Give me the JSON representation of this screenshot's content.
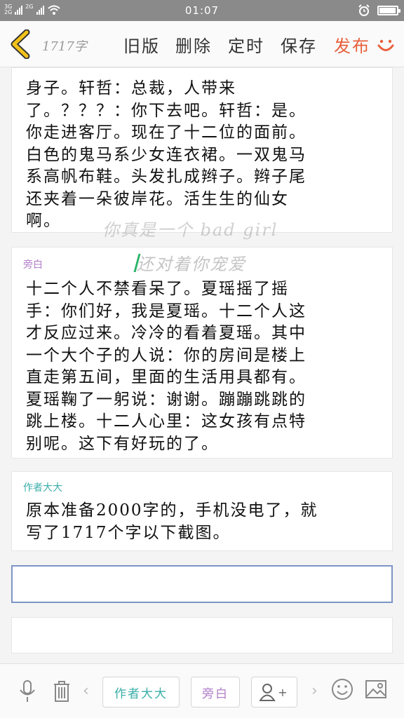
{
  "status_bar": {
    "network_1": "3G",
    "network_2": "2G",
    "network_3": "2G",
    "time": "01:07",
    "battery_level": 0.95
  },
  "toolbar": {
    "word_count": "1717字",
    "old_version_label": "旧版",
    "delete_label": "删除",
    "schedule_label": "定时",
    "save_label": "保存",
    "publish_label": "发布",
    "accent_color": "#e8613c"
  },
  "content": {
    "card1_text": "身子。轩哲：总裁，人带来\n了。？？？：你下去吧。轩哲：是。\n你走进客厅。现在了十二位的面前。\n白色的鬼马系少女连衣裙。一双鬼马\n系高帆布鞋。头发扎成辫子。辫子尾\n还夹着一朵彼岸花。活生生的仙女\n啊。",
    "card2_label": "旁白",
    "card2_text": "十二个人不禁看呆了。夏瑶摇了摇\n手：你们好，我是夏瑶。十二个人这\n才反应过来。冷冷的看着夏瑶。其中\n一个大个子的人说：你的房间是楼上\n直走第五间，里面的生活用具都有。\n夏瑶鞠了一躬说：谢谢。蹦蹦跳跳的\n跳上楼。十二人心里：这女孩有点特\n别呢。这下有好玩的了。",
    "card3_label": "作者大大",
    "card3_text": "原本准备2000字的，手机没电了，就\n写了1717个字以下截图。",
    "watermark_line1": "你真是一个 bad girl",
    "watermark_line2": "还对着你宠爱",
    "input_value": ""
  },
  "bottom_bar": {
    "author_chip": "作者大大",
    "narration_chip": "旁白",
    "add_chip_symbol": "+",
    "icons": [
      "microphone-icon",
      "trash-icon",
      "chevron-left-icon",
      "chevron-right-icon",
      "emoji-icon",
      "image-icon",
      "add-user-icon"
    ]
  }
}
